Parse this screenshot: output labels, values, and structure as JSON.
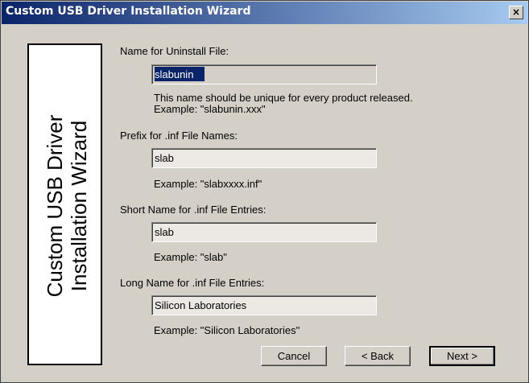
{
  "window": {
    "title": "Custom USB Driver Installation Wizard",
    "close_label": "×"
  },
  "side_panel": {
    "line1": "Custom USB Driver",
    "line2": "Installation Wizard"
  },
  "fields": {
    "uninstall": {
      "label": "Name for Uninstall File:",
      "value": "slabunin",
      "hint1": "This name should be unique for every product released.",
      "hint2": "Example: \"slabunin.xxx\""
    },
    "inf_prefix": {
      "label": "Prefix for .inf File Names:",
      "value": "slab",
      "hint": "Example: \"slabxxxx.inf\""
    },
    "short_name": {
      "label": "Short Name for .inf File Entries:",
      "value": "slab",
      "hint": "Example: \"slab\""
    },
    "long_name": {
      "label": "Long Name for .inf File Entries:",
      "value": "Silicon Laboratories",
      "hint": "Example: \"Silicon Laboratories\""
    }
  },
  "buttons": {
    "cancel": "Cancel",
    "back": "< Back",
    "next": "Next >"
  }
}
